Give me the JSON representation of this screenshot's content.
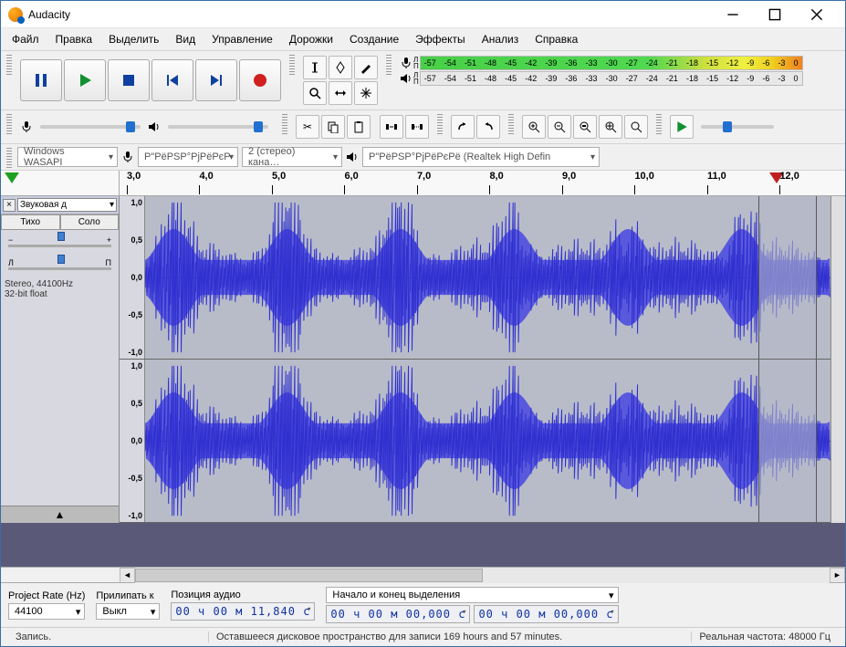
{
  "window": {
    "title": "Audacity"
  },
  "menu": [
    "Файл",
    "Правка",
    "Выделить",
    "Вид",
    "Управление",
    "Дорожки",
    "Создание",
    "Эффекты",
    "Анализ",
    "Справка"
  ],
  "meter": {
    "ticks": [
      "-57",
      "-54",
      "-51",
      "-48",
      "-45",
      "-42",
      "-39",
      "-36",
      "-33",
      "-30",
      "-27",
      "-24",
      "-21",
      "-18",
      "-15",
      "-12",
      "-9",
      "-6",
      "-3",
      "0"
    ],
    "rec_label_l": "Л",
    "rec_label_p": "П"
  },
  "devices": {
    "host": "Windows WASAPI",
    "rec_device": "P\"PëPSP°PjPëPєP",
    "channels": "2 (стерео) кана…",
    "play_device": "P\"PëPSP°PjPëPєPë (Realtek High Defin"
  },
  "ruler": {
    "values": [
      "3,0",
      "4,0",
      "5,0",
      "6,0",
      "7,0",
      "8,0",
      "9,0",
      "10,0",
      "11,0",
      "12,0"
    ]
  },
  "track": {
    "name": "Звуковая д",
    "mute": "Тихо",
    "solo": "Соло",
    "pan_l": "Л",
    "pan_r": "П",
    "format_line1": "Stereo, 44100Hz",
    "format_line2": "32-bit float",
    "db_labels": [
      "1,0",
      "0,5",
      "0,0",
      "-0,5",
      "-1,0"
    ]
  },
  "bottom": {
    "rate_label": "Project Rate (Hz)",
    "rate_value": "44100",
    "snap_label": "Прилипать к",
    "snap_value": "Выкл",
    "pos_label": "Позиция аудио",
    "pos_value": "00 ч 00 м 11,840 с",
    "sel_label": "Начало и конец выделения",
    "sel_start": "00 ч 00 м 00,000 с",
    "sel_end": "00 ч 00 м 00,000 с"
  },
  "status": {
    "left": "Запись.",
    "center": "Оставшееся дисковое пространство для записи 169 hours and 57 minutes.",
    "right": "Реальная частота: 48000 Гц"
  }
}
